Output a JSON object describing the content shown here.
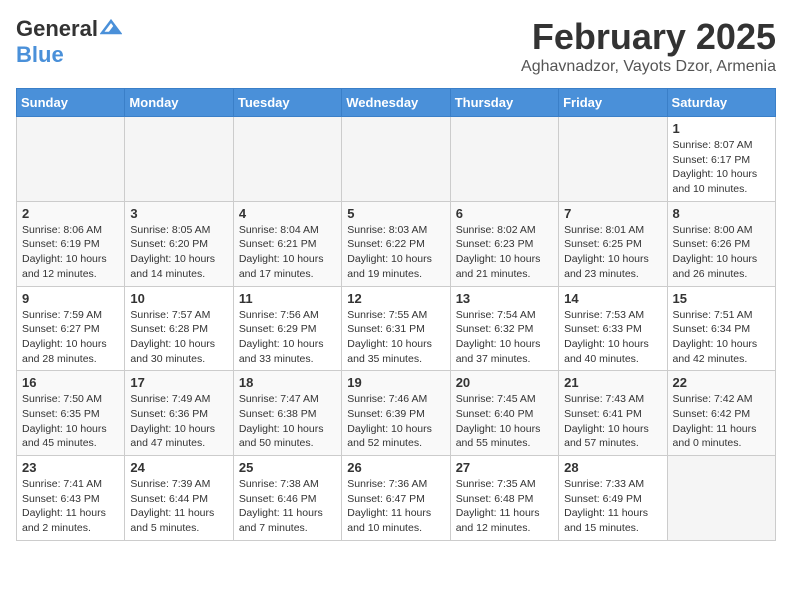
{
  "header": {
    "logo_line1": "General",
    "logo_line2": "Blue",
    "title": "February 2025",
    "subtitle": "Aghavnadzor, Vayots Dzor, Armenia"
  },
  "days_of_week": [
    "Sunday",
    "Monday",
    "Tuesday",
    "Wednesday",
    "Thursday",
    "Friday",
    "Saturday"
  ],
  "weeks": [
    [
      {
        "day": "",
        "info": ""
      },
      {
        "day": "",
        "info": ""
      },
      {
        "day": "",
        "info": ""
      },
      {
        "day": "",
        "info": ""
      },
      {
        "day": "",
        "info": ""
      },
      {
        "day": "",
        "info": ""
      },
      {
        "day": "1",
        "info": "Sunrise: 8:07 AM\nSunset: 6:17 PM\nDaylight: 10 hours and 10 minutes."
      }
    ],
    [
      {
        "day": "2",
        "info": "Sunrise: 8:06 AM\nSunset: 6:19 PM\nDaylight: 10 hours and 12 minutes."
      },
      {
        "day": "3",
        "info": "Sunrise: 8:05 AM\nSunset: 6:20 PM\nDaylight: 10 hours and 14 minutes."
      },
      {
        "day": "4",
        "info": "Sunrise: 8:04 AM\nSunset: 6:21 PM\nDaylight: 10 hours and 17 minutes."
      },
      {
        "day": "5",
        "info": "Sunrise: 8:03 AM\nSunset: 6:22 PM\nDaylight: 10 hours and 19 minutes."
      },
      {
        "day": "6",
        "info": "Sunrise: 8:02 AM\nSunset: 6:23 PM\nDaylight: 10 hours and 21 minutes."
      },
      {
        "day": "7",
        "info": "Sunrise: 8:01 AM\nSunset: 6:25 PM\nDaylight: 10 hours and 23 minutes."
      },
      {
        "day": "8",
        "info": "Sunrise: 8:00 AM\nSunset: 6:26 PM\nDaylight: 10 hours and 26 minutes."
      }
    ],
    [
      {
        "day": "9",
        "info": "Sunrise: 7:59 AM\nSunset: 6:27 PM\nDaylight: 10 hours and 28 minutes."
      },
      {
        "day": "10",
        "info": "Sunrise: 7:57 AM\nSunset: 6:28 PM\nDaylight: 10 hours and 30 minutes."
      },
      {
        "day": "11",
        "info": "Sunrise: 7:56 AM\nSunset: 6:29 PM\nDaylight: 10 hours and 33 minutes."
      },
      {
        "day": "12",
        "info": "Sunrise: 7:55 AM\nSunset: 6:31 PM\nDaylight: 10 hours and 35 minutes."
      },
      {
        "day": "13",
        "info": "Sunrise: 7:54 AM\nSunset: 6:32 PM\nDaylight: 10 hours and 37 minutes."
      },
      {
        "day": "14",
        "info": "Sunrise: 7:53 AM\nSunset: 6:33 PM\nDaylight: 10 hours and 40 minutes."
      },
      {
        "day": "15",
        "info": "Sunrise: 7:51 AM\nSunset: 6:34 PM\nDaylight: 10 hours and 42 minutes."
      }
    ],
    [
      {
        "day": "16",
        "info": "Sunrise: 7:50 AM\nSunset: 6:35 PM\nDaylight: 10 hours and 45 minutes."
      },
      {
        "day": "17",
        "info": "Sunrise: 7:49 AM\nSunset: 6:36 PM\nDaylight: 10 hours and 47 minutes."
      },
      {
        "day": "18",
        "info": "Sunrise: 7:47 AM\nSunset: 6:38 PM\nDaylight: 10 hours and 50 minutes."
      },
      {
        "day": "19",
        "info": "Sunrise: 7:46 AM\nSunset: 6:39 PM\nDaylight: 10 hours and 52 minutes."
      },
      {
        "day": "20",
        "info": "Sunrise: 7:45 AM\nSunset: 6:40 PM\nDaylight: 10 hours and 55 minutes."
      },
      {
        "day": "21",
        "info": "Sunrise: 7:43 AM\nSunset: 6:41 PM\nDaylight: 10 hours and 57 minutes."
      },
      {
        "day": "22",
        "info": "Sunrise: 7:42 AM\nSunset: 6:42 PM\nDaylight: 11 hours and 0 minutes."
      }
    ],
    [
      {
        "day": "23",
        "info": "Sunrise: 7:41 AM\nSunset: 6:43 PM\nDaylight: 11 hours and 2 minutes."
      },
      {
        "day": "24",
        "info": "Sunrise: 7:39 AM\nSunset: 6:44 PM\nDaylight: 11 hours and 5 minutes."
      },
      {
        "day": "25",
        "info": "Sunrise: 7:38 AM\nSunset: 6:46 PM\nDaylight: 11 hours and 7 minutes."
      },
      {
        "day": "26",
        "info": "Sunrise: 7:36 AM\nSunset: 6:47 PM\nDaylight: 11 hours and 10 minutes."
      },
      {
        "day": "27",
        "info": "Sunrise: 7:35 AM\nSunset: 6:48 PM\nDaylight: 11 hours and 12 minutes."
      },
      {
        "day": "28",
        "info": "Sunrise: 7:33 AM\nSunset: 6:49 PM\nDaylight: 11 hours and 15 minutes."
      },
      {
        "day": "",
        "info": ""
      }
    ]
  ]
}
